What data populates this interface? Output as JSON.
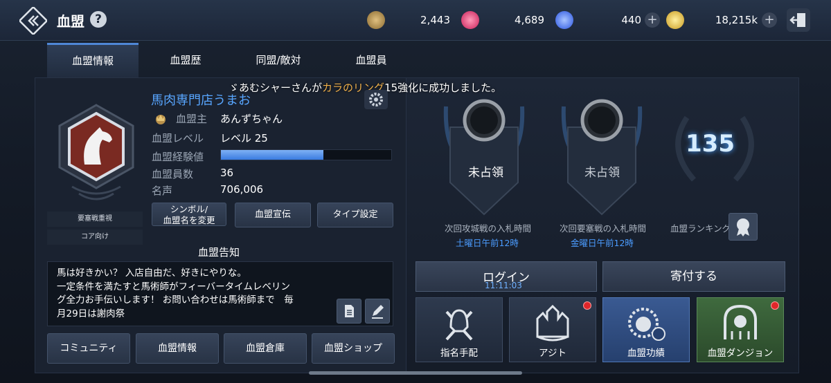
{
  "header": {
    "title": "血盟",
    "help": "?"
  },
  "currencies": [
    {
      "icon": "medal-coin-icon",
      "value": "2,443",
      "color": "#c8a060"
    },
    {
      "icon": "red-gem-icon",
      "value": "4,689",
      "color": "#e83a70"
    },
    {
      "icon": "blue-gem-icon",
      "value": "440",
      "color": "#4a7bff"
    },
    {
      "icon": "gold-coin-icon",
      "value": "18,215k",
      "color": "#e8c040"
    }
  ],
  "tabs": [
    "血盟情報",
    "血盟歴",
    "同盟/敵対",
    "血盟員"
  ],
  "notice_banner": {
    "pre": "ゞあむシャーさんが",
    "highlight": "カラのリング",
    "post": "15強化に成功しました。"
  },
  "clan": {
    "name": "馬肉専門店うまお",
    "rows": [
      {
        "label": "血盟主",
        "value": "あんずちゃん"
      },
      {
        "label": "血盟レベル",
        "value": "レベル 25"
      },
      {
        "label": "血盟経験値",
        "value": ""
      },
      {
        "label": "血盟員数",
        "value": "36"
      },
      {
        "label": "名声",
        "value": "706,006"
      }
    ],
    "exp_progress": 0.6,
    "tags": [
      "要塞戦重視",
      "コア向け"
    ]
  },
  "action_buttons": {
    "symbol": "シンボル/\n血盟名を変更",
    "promote": "血盟宣伝",
    "type": "タイプ設定"
  },
  "announcement": {
    "title": "血盟告知",
    "text": [
      "馬は好きかい？ 入店自由だ、好きにやりな。",
      "一定条件を満たすと馬術師がフィーバータイムレベリン",
      "グ全力お手伝いします！ お問い合わせは馬術師まで　毎",
      "月29日は謝肉祭"
    ]
  },
  "bottom_buttons": [
    "コミュニティ",
    "血盟情報",
    "血盟倉庫",
    "血盟ショップ"
  ],
  "castles": [
    {
      "status": "未占領",
      "caption": "次回攻城戦の入札時間",
      "time": "土曜日午前12時"
    },
    {
      "status": "未占領",
      "caption": "次回要塞戦の入札時間",
      "time": "金曜日午前12時"
    }
  ],
  "ranking": {
    "value": "135",
    "label": "血盟ランキング"
  },
  "login": {
    "label": "ログイン",
    "timer": "11:11:03"
  },
  "donate": {
    "label": "寄付する"
  },
  "cards": [
    {
      "label": "指名手配",
      "dot": false
    },
    {
      "label": "アジト",
      "dot": true
    },
    {
      "label": "血盟功績",
      "dot": false
    },
    {
      "label": "血盟ダンジョン",
      "dot": true
    }
  ]
}
